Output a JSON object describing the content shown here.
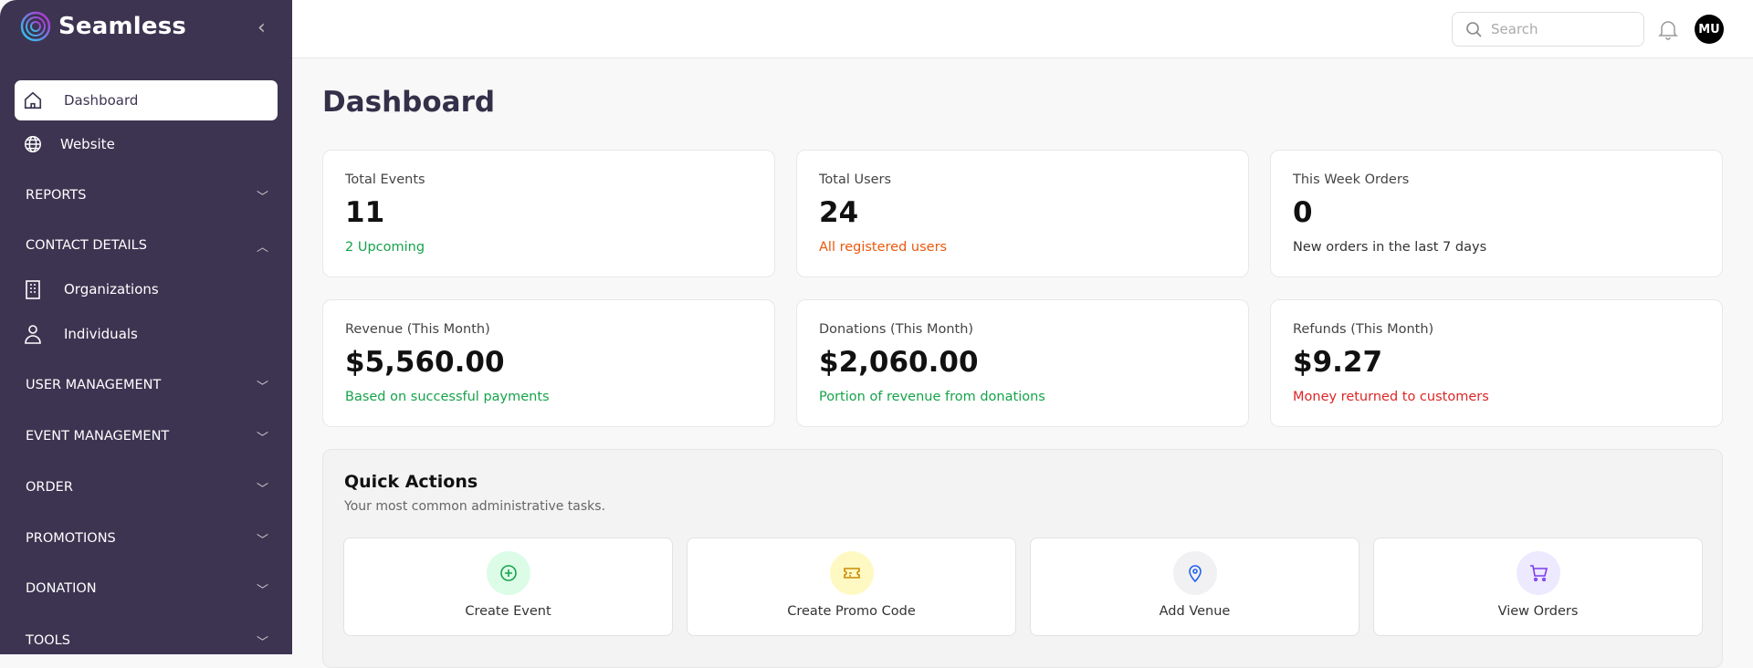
{
  "brand": {
    "name": "Seamless"
  },
  "sidebar": {
    "items": [
      {
        "label": "Dashboard",
        "icon": "home-icon"
      },
      {
        "label": "Website",
        "icon": "globe-icon"
      }
    ],
    "sections": [
      "REPORTS",
      "CONTACT DETAILS",
      "USER MANAGEMENT",
      "EVENT MANAGEMENT",
      "ORDER",
      "PROMOTIONS",
      "DONATION",
      "TOOLS"
    ],
    "contact_items": [
      {
        "label": "Organizations",
        "icon": "building-icon"
      },
      {
        "label": "Individuals",
        "icon": "user-icon"
      }
    ]
  },
  "header": {
    "search_placeholder": "Search",
    "avatar": "MU"
  },
  "page": {
    "title": "Dashboard"
  },
  "stats": [
    {
      "label": "Total Events",
      "value": "11",
      "sub": "2 Upcoming",
      "color": "#16a34a"
    },
    {
      "label": "Total Users",
      "value": "24",
      "sub": "All registered users",
      "color": "#ea580c"
    },
    {
      "label": "This Week Orders",
      "value": "0",
      "sub": "New orders in the last 7 days",
      "color": "#333333"
    },
    {
      "label": "Revenue (This Month)",
      "value": "$5,560.00",
      "sub": "Based on successful payments",
      "color": "#16a34a"
    },
    {
      "label": "Donations (This Month)",
      "value": "$2,060.00",
      "sub": "Portion of revenue from donations",
      "color": "#16a34a"
    },
    {
      "label": "Refunds (This Month)",
      "value": "$9.27",
      "sub": "Money returned to customers",
      "color": "#dc2626"
    }
  ],
  "quick_actions": {
    "title": "Quick Actions",
    "subtitle": "Your most common administrative tasks.",
    "items": [
      {
        "label": "Create Event",
        "bg": "#dcfce7",
        "fg": "#16a34a"
      },
      {
        "label": "Create Promo Code",
        "bg": "#fef9c3",
        "fg": "#ca8a04"
      },
      {
        "label": "Add Venue",
        "bg": "#f1f1f3",
        "fg": "#2563eb"
      },
      {
        "label": "View Orders",
        "bg": "#ede9fe",
        "fg": "#7c3aed"
      }
    ]
  }
}
